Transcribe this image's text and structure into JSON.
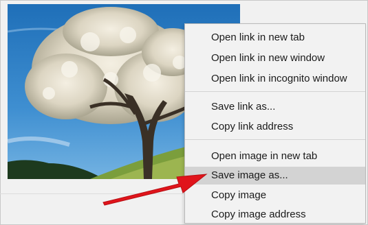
{
  "context_menu": {
    "items": [
      {
        "label": "Open link in new tab"
      },
      {
        "label": "Open link in new window"
      },
      {
        "label": "Open link in incognito window"
      },
      {
        "label": "Save link as..."
      },
      {
        "label": "Copy link address"
      },
      {
        "label": "Open image in new tab"
      },
      {
        "label": "Save image as..."
      },
      {
        "label": "Copy image"
      },
      {
        "label": "Copy image address"
      }
    ],
    "highlighted_item": "Save image as..."
  },
  "colors": {
    "menu_background": "#f2f2f2",
    "highlight": "#d3d3d3",
    "arrow": "#e0141b",
    "sky": "#2f7fc1"
  },
  "icons": {
    "annotation_arrow": "red-arrow-icon"
  }
}
